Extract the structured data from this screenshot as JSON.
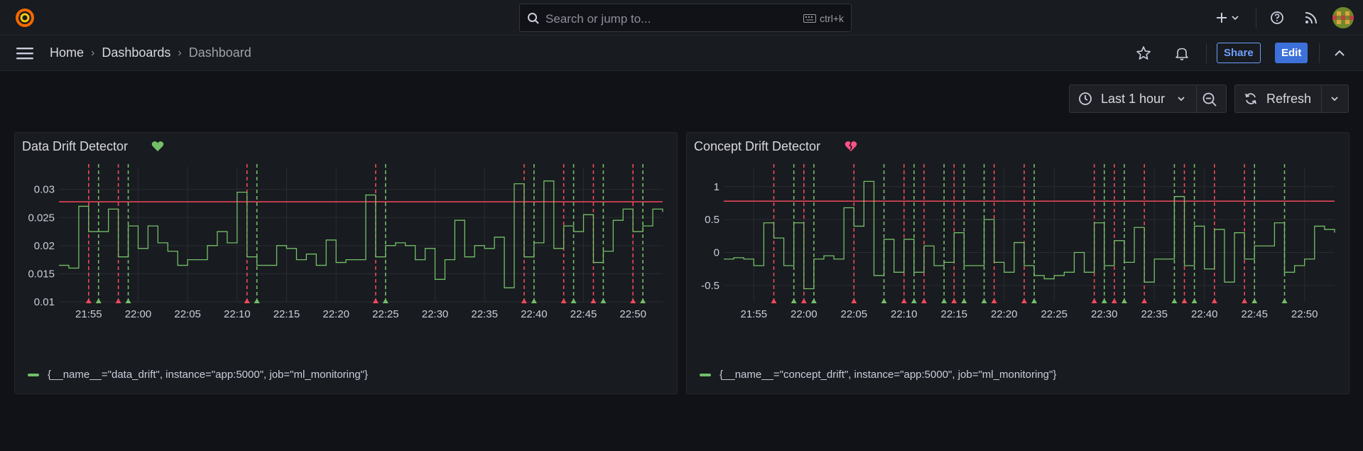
{
  "search": {
    "placeholder": "Search or jump to...",
    "shortcut": "ctrl+k"
  },
  "breadcrumb": [
    "Home",
    "Dashboards",
    "Dashboard"
  ],
  "toolbar": {
    "share_label": "Share",
    "edit_label": "Edit"
  },
  "time_range": {
    "label": "Last 1 hour"
  },
  "refresh": {
    "label": "Refresh"
  },
  "colors": {
    "series": "#73bf69",
    "threshold": "#f2495c",
    "annotation_up": "#73bf69",
    "annotation_down": "#f2495c",
    "status_ok": "#73bf69",
    "status_alert": "#ff5286"
  },
  "panels": [
    {
      "title": "Data Drift Detector",
      "status_icon": "heart-icon",
      "legend": "{__name__=\"data_drift\", instance=\"app:5000\", job=\"ml_monitoring\"}"
    },
    {
      "title": "Concept Drift Detector",
      "status_icon": "broken-heart-icon",
      "legend": "{__name__=\"concept_drift\", instance=\"app:5000\", job=\"ml_monitoring\"}"
    }
  ],
  "chart_data": [
    {
      "type": "line",
      "title": "Data Drift Detector",
      "ylim": [
        0.01,
        0.034
      ],
      "yticks": [
        0.01,
        0.015,
        0.02,
        0.025,
        0.03
      ],
      "ytick_labels": [
        "0.01",
        "0.015",
        "0.02",
        "0.025",
        "0.03"
      ],
      "xlim": [
        "21:52",
        "22:53"
      ],
      "xticks": [
        "21:55",
        "22:00",
        "22:05",
        "22:10",
        "22:15",
        "22:20",
        "22:25",
        "22:30",
        "22:35",
        "22:40",
        "22:45",
        "22:50"
      ],
      "threshold": 0.0278,
      "grid": true,
      "series": [
        {
          "x": [
            "21:52",
            "21:53",
            "21:54",
            "21:55",
            "21:56",
            "21:57",
            "21:58",
            "21:59",
            "22:00",
            "22:01",
            "22:02",
            "22:03",
            "22:04",
            "22:05",
            "22:06",
            "22:07",
            "22:08",
            "22:09",
            "22:10",
            "22:11",
            "22:12",
            "22:13",
            "22:14",
            "22:15",
            "22:16",
            "22:17",
            "22:18",
            "22:19",
            "22:20",
            "22:21",
            "22:22",
            "22:23",
            "22:24",
            "22:25",
            "22:26",
            "22:27",
            "22:28",
            "22:29",
            "22:30",
            "22:31",
            "22:32",
            "22:33",
            "22:34",
            "22:35",
            "22:36",
            "22:37",
            "22:38",
            "22:39",
            "22:40",
            "22:41",
            "22:42",
            "22:43",
            "22:44",
            "22:45",
            "22:46",
            "22:47",
            "22:48",
            "22:49",
            "22:50",
            "22:51",
            "22:52",
            "22:53"
          ],
          "values": [
            0.0165,
            0.016,
            0.027,
            0.0225,
            0.0225,
            0.0265,
            0.018,
            0.0235,
            0.0195,
            0.0235,
            0.0205,
            0.019,
            0.0165,
            0.0175,
            0.0175,
            0.02,
            0.0225,
            0.0205,
            0.0295,
            0.018,
            0.0165,
            0.0165,
            0.02,
            0.0195,
            0.0175,
            0.0185,
            0.0165,
            0.021,
            0.017,
            0.0175,
            0.0175,
            0.029,
            0.018,
            0.02,
            0.0205,
            0.02,
            0.0175,
            0.0195,
            0.014,
            0.0175,
            0.0245,
            0.018,
            0.02,
            0.0195,
            0.0215,
            0.0125,
            0.031,
            0.018,
            0.0205,
            0.0315,
            0.0195,
            0.0235,
            0.0225,
            0.0255,
            0.017,
            0.019,
            0.0245,
            0.0265,
            0.0225,
            0.0235,
            0.0265,
            0.026
          ]
        }
      ],
      "annotations_down": [
        "21:55",
        "21:58",
        "22:11",
        "22:24",
        "22:39",
        "22:43",
        "22:46",
        "22:50"
      ],
      "annotations_up": [
        "21:56",
        "21:59",
        "22:12",
        "22:25",
        "22:40",
        "22:44",
        "22:47",
        "22:51"
      ]
    },
    {
      "type": "line",
      "title": "Concept Drift Detector",
      "ylim": [
        -0.75,
        1.3
      ],
      "yticks": [
        -0.5,
        0,
        0.5,
        1
      ],
      "ytick_labels": [
        "-0.5",
        "0",
        "0.5",
        "1"
      ],
      "xlim": [
        "21:52",
        "22:53"
      ],
      "xticks": [
        "21:55",
        "22:00",
        "22:05",
        "22:10",
        "22:15",
        "22:20",
        "22:25",
        "22:30",
        "22:35",
        "22:40",
        "22:45",
        "22:50"
      ],
      "threshold": 0.78,
      "grid": true,
      "series": [
        {
          "x": [
            "21:52",
            "21:53",
            "21:54",
            "21:55",
            "21:56",
            "21:57",
            "21:58",
            "21:59",
            "22:00",
            "22:01",
            "22:02",
            "22:03",
            "22:04",
            "22:05",
            "22:06",
            "22:07",
            "22:08",
            "22:09",
            "22:10",
            "22:11",
            "22:12",
            "22:13",
            "22:14",
            "22:15",
            "22:16",
            "22:17",
            "22:18",
            "22:19",
            "22:20",
            "22:21",
            "22:22",
            "22:23",
            "22:24",
            "22:25",
            "22:26",
            "22:27",
            "22:28",
            "22:29",
            "22:30",
            "22:31",
            "22:32",
            "22:33",
            "22:34",
            "22:35",
            "22:36",
            "22:37",
            "22:38",
            "22:39",
            "22:40",
            "22:41",
            "22:42",
            "22:43",
            "22:44",
            "22:45",
            "22:46",
            "22:47",
            "22:48",
            "22:49",
            "22:50",
            "22:51",
            "22:52",
            "22:53"
          ],
          "values": [
            -0.1,
            -0.08,
            -0.1,
            -0.2,
            0.45,
            0.22,
            -0.2,
            0.45,
            -0.55,
            -0.1,
            -0.05,
            -0.1,
            0.68,
            0.4,
            1.08,
            -0.35,
            0.2,
            -0.3,
            0.2,
            -0.3,
            0.1,
            -0.2,
            -0.15,
            0.3,
            -0.2,
            -0.2,
            0.5,
            -0.15,
            -0.3,
            0.15,
            -0.2,
            -0.35,
            -0.4,
            -0.35,
            -0.3,
            0.0,
            -0.3,
            0.45,
            -0.2,
            0.18,
            -0.15,
            0.38,
            -0.45,
            -0.1,
            -0.1,
            0.85,
            -0.2,
            0.4,
            -0.25,
            0.35,
            -0.45,
            0.3,
            -0.1,
            0.1,
            0.1,
            0.45,
            -0.3,
            -0.2,
            -0.1,
            0.4,
            0.35,
            0.3
          ]
        }
      ],
      "annotations_down": [
        "21:57",
        "22:00",
        "22:05",
        "22:10",
        "22:12",
        "22:15",
        "22:19",
        "22:22",
        "22:29",
        "22:31",
        "22:34",
        "22:38",
        "22:41",
        "22:44"
      ],
      "annotations_up": [
        "21:59",
        "22:01",
        "22:08",
        "22:11",
        "22:14",
        "22:16",
        "22:18",
        "22:23",
        "22:30",
        "22:32",
        "22:37",
        "22:39",
        "22:45",
        "22:48"
      ]
    }
  ]
}
